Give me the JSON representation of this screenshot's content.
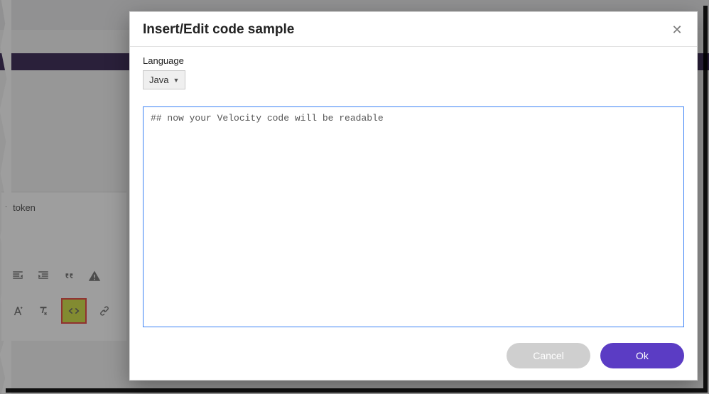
{
  "dialog": {
    "title": "Insert/Edit code sample",
    "language_label": "Language",
    "language_value": "Java",
    "code_value": "## now your Velocity code will be readable",
    "cancel_label": "Cancel",
    "ok_label": "Ok"
  },
  "background": {
    "token_fragment": "y token"
  },
  "icons": {
    "outdent": "outdent-icon",
    "indent": "indent-icon",
    "quote": "quote-icon",
    "warning": "warning-icon",
    "font": "font-icon",
    "clear_format": "clear-format-icon",
    "code": "code-icon",
    "link": "link-icon",
    "close": "close-icon",
    "caret": "caret-down-icon"
  },
  "colors": {
    "accent": "#5b3cc4",
    "highlight_bg": "#cddc39",
    "highlight_border": "#e53935",
    "focus_border": "#3b82f6"
  }
}
